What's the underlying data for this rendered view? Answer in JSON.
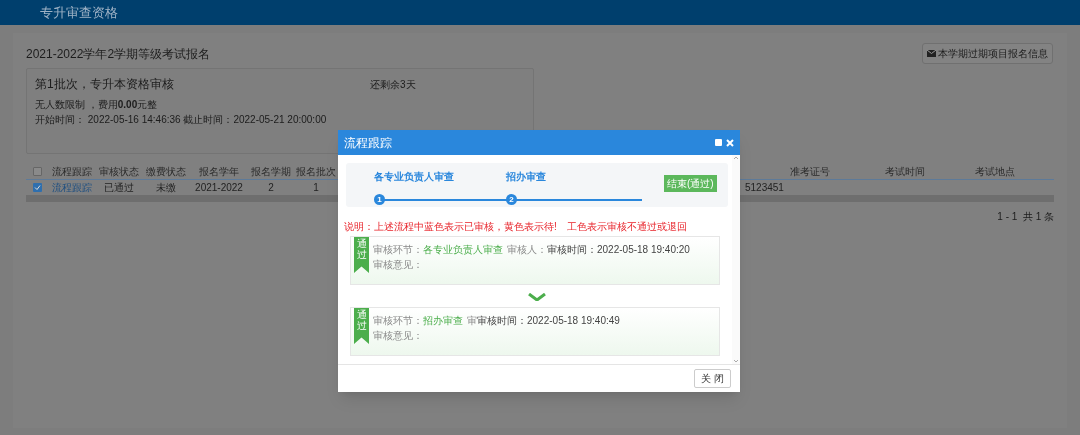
{
  "header": {
    "title": "专升审查资格"
  },
  "page": {
    "title": "2021-2022学年2学期等级考试报名",
    "history_button": "本学期过期项目报名信息"
  },
  "batch": {
    "title": "第1批次，专升本资格审核",
    "remaining": "还剩余3天",
    "limit": "无人数限制 ，费用**0.00**元整",
    "times": "开始时间： 2022-05-16 14:46:36 截止时间：2022-05-21 20:00:00"
  },
  "table": {
    "header_checked": false,
    "columns": [
      "流程跟踪",
      "审核状态",
      "缴费状态",
      "报名学年",
      "报名学期",
      "报名批次"
    ],
    "right_columns": [
      "准考证号",
      "考试时间",
      "考试地点"
    ],
    "rows": [
      {
        "checked": true,
        "cells": [
          "流程跟踪",
          "已通过",
          "未缴",
          "2021-2022",
          "2",
          "1"
        ],
        "partial_cell": "5123451"
      }
    ],
    "pagination": "1 - 1  共 1 条"
  },
  "dialog": {
    "title": "流程跟踪",
    "steps": [
      {
        "number": "1",
        "label": "各专业负责人审查"
      },
      {
        "number": "2",
        "label": "招办审查"
      }
    ],
    "end_badge": "结束(通过)",
    "notes": [
      "说明：上述流程中蓝色表示已审核，黄色表示待!",
      "工色表示审核不通过或退回"
    ],
    "records": [
      {
        "ribbon": "通过",
        "stage_label": "审核环节：",
        "stage": "各专业负责人审查",
        "reviewer": "审核人：",
        "time": "审核时间：2022-05-18 19:40:20",
        "opinion": "审核意见："
      },
      {
        "ribbon": "通过",
        "stage_label": "审核环节：",
        "stage": "招办审查",
        "reviewer": "审",
        "time": "审核时间：2022-05-18 19:40:49",
        "opinion": "审核意见："
      }
    ],
    "close_button": "关 闭"
  }
}
